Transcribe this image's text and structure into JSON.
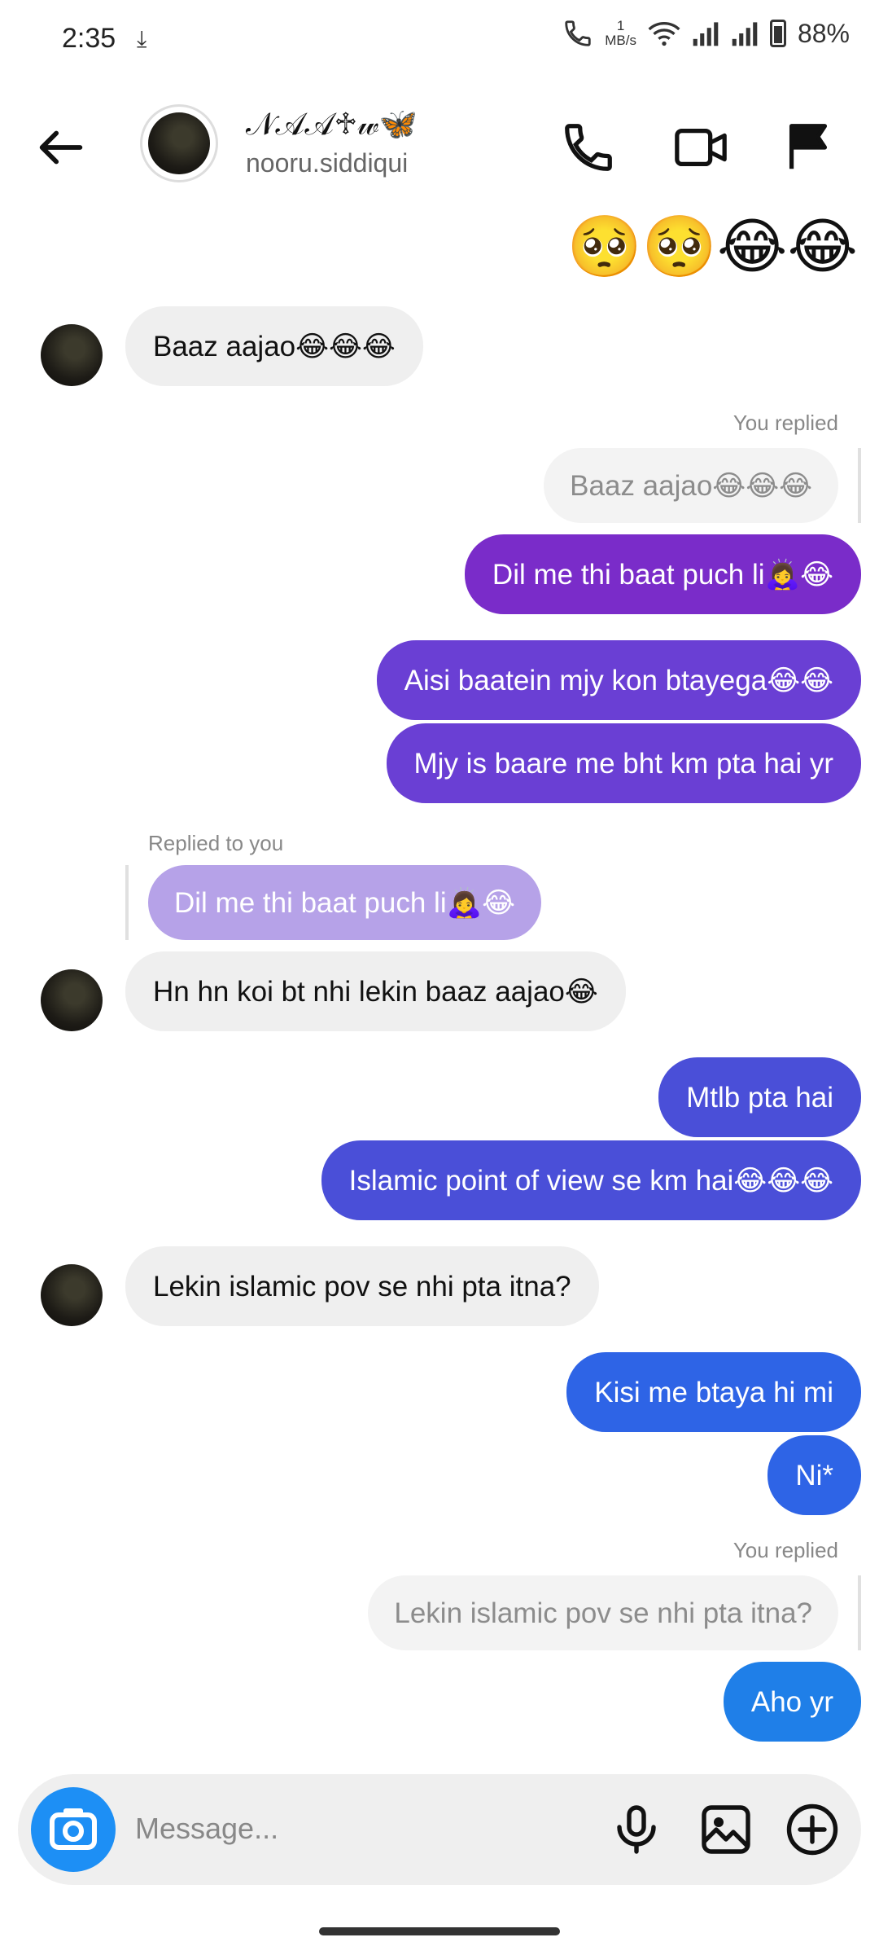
{
  "status_bar": {
    "time": "2:35",
    "download_icon": "⤓",
    "speed_value": "1",
    "speed_unit": "MB/s",
    "battery": "88%"
  },
  "header": {
    "name": "𝒩𝒜𝒜♱𝓌🦋",
    "username": "nooru.siddiqui",
    "icons": [
      "back-arrow-icon",
      "phone-icon",
      "video-camera-icon",
      "flag-icon"
    ]
  },
  "messages": {
    "top_emojis": "🥺🥺😂😂",
    "m1": "Baaz aajao😂😂😂",
    "reply1_label": "You replied",
    "reply1_quote": "Baaz aajao😂😂😂",
    "m2": "Dil me thi baat puch li🙇‍♀️😂",
    "m3": "Aisi baatein mjy kon btayega😂😂",
    "m4": "Mjy is baare me bht km pta hai yr",
    "reply2_label": "Replied to you",
    "reply2_quote": "Dil me thi baat puch li🙇‍♀️😂",
    "m5": "Hn hn koi bt nhi lekin baaz aajao😂",
    "m6": "Mtlb pta hai",
    "m7": "Islamic point of view se km hai😂😂😂",
    "m8": "Lekin islamic pov se nhi pta itna?",
    "m9": "Kisi me btaya hi mi",
    "m10": "Ni*",
    "reply3_label": "You replied",
    "reply3_quote": "Lekin islamic pov se nhi pta itna?",
    "m11": "Aho yr"
  },
  "composer": {
    "placeholder": "Message...",
    "icons": [
      "camera-icon",
      "microphone-icon",
      "gallery-icon",
      "plus-icon"
    ]
  },
  "colors": {
    "purple": "#7a2cc9",
    "violet": "#6a3fd4",
    "indigo": "#4a4fd8",
    "blue": "#2e64e6",
    "bright_blue": "#1f7fe8",
    "incoming": "#efefef"
  }
}
